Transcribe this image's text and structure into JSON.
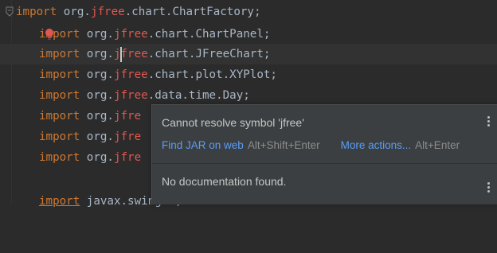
{
  "editor": {
    "lines": [
      {
        "kw": "import",
        "pre": " org.",
        "pkg": "jfree",
        "post": ".chart.ChartFactory;"
      },
      {
        "kw": "import",
        "pre": " org.",
        "pkg": "jfree",
        "post": ".chart.ChartPanel;"
      },
      {
        "kw": "import",
        "pre": " org.",
        "pkg": "jfree",
        "post": ".chart.JFreeChart;"
      },
      {
        "kw": "import",
        "pre": " org.",
        "pkg": "jfree",
        "post": ".chart.plot.XYPlot;"
      },
      {
        "kw": "import",
        "pre": " org.",
        "pkg": "jfree",
        "post": ".data.time.Day;"
      },
      {
        "kw": "import",
        "pre": " org.",
        "pkg": "jfre",
        "post": ""
      },
      {
        "kw": "import",
        "pre": " org.",
        "pkg": "jfre",
        "post": ""
      },
      {
        "kw": "import",
        "pre": " org.",
        "pkg": "jfre",
        "post": ""
      },
      {
        "kw": "import",
        "pre": " javax.swing.*;",
        "pkg": "",
        "post": ""
      }
    ]
  },
  "popup": {
    "title": "Cannot resolve symbol 'jfree'",
    "action1_label": "Find JAR on web",
    "action1_shortcut": "Alt+Shift+Enter",
    "action2_label": "More actions...",
    "action2_shortcut": "Alt+Enter",
    "doc_text": "No documentation found."
  },
  "colors": {
    "background": "#2b2b2b",
    "keyword": "#cc7832",
    "error": "#e0574f",
    "link": "#589df6",
    "popup_bg": "#3c3f41"
  },
  "icons": [
    "fold-icon",
    "error-bulb-icon",
    "more-options-icon"
  ]
}
